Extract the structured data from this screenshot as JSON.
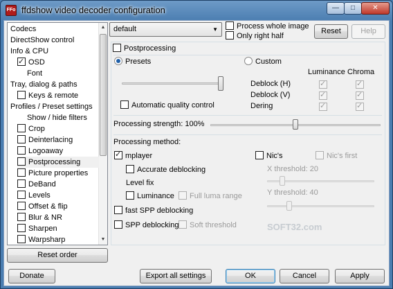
{
  "window": {
    "title": "ffdshow video decoder configuration",
    "icon_text": "FFo",
    "close_glyph": "✕",
    "minimize_glyph": "—",
    "maximize_glyph": "□"
  },
  "tree": {
    "items": [
      {
        "label": "Codecs",
        "indent": 0,
        "checkbox": null
      },
      {
        "label": "DirectShow control",
        "indent": 0,
        "checkbox": null
      },
      {
        "label": "Info & CPU",
        "indent": 0,
        "checkbox": null
      },
      {
        "label": "OSD",
        "indent": 1,
        "checkbox": true
      },
      {
        "label": "Font",
        "indent": 2,
        "checkbox": null
      },
      {
        "label": "Tray, dialog & paths",
        "indent": 0,
        "checkbox": null
      },
      {
        "label": "Keys & remote",
        "indent": 1,
        "checkbox": false
      },
      {
        "label": "Profiles / Preset settings",
        "indent": 0,
        "checkbox": null
      },
      {
        "label": "Show / hide filters",
        "indent": 2,
        "checkbox": null
      },
      {
        "label": "Crop",
        "indent": 1,
        "checkbox": false
      },
      {
        "label": "Deinterlacing",
        "indent": 1,
        "checkbox": false
      },
      {
        "label": "Logoaway",
        "indent": 1,
        "checkbox": false
      },
      {
        "label": "Postprocessing",
        "indent": 1,
        "checkbox": false,
        "selected": true
      },
      {
        "label": "Picture properties",
        "indent": 1,
        "checkbox": false
      },
      {
        "label": "DeBand",
        "indent": 1,
        "checkbox": false
      },
      {
        "label": "Levels",
        "indent": 1,
        "checkbox": false
      },
      {
        "label": "Offset & flip",
        "indent": 1,
        "checkbox": false
      },
      {
        "label": "Blur & NR",
        "indent": 1,
        "checkbox": false
      },
      {
        "label": "Sharpen",
        "indent": 1,
        "checkbox": false
      },
      {
        "label": "Warpsharp",
        "indent": 1,
        "checkbox": false
      }
    ],
    "reset_order_label": "Reset order"
  },
  "preset": {
    "selected": "default",
    "process_whole_image_label": "Process whole image",
    "process_whole_image_checked": false,
    "only_right_half_label": "Only right half",
    "only_right_half_checked": false,
    "reset_label": "Reset",
    "help_label": "Help"
  },
  "postproc": {
    "enable_label": "Postprocessing",
    "enable_checked": false,
    "presets_label": "Presets",
    "presets_selected": true,
    "custom_label": "Custom",
    "custom_selected": false,
    "preset_slider_fraction": 1.0,
    "auto_quality_label": "Automatic quality control",
    "auto_quality_checked": false,
    "col_luminance": "Luminance",
    "col_chroma": "Chroma",
    "rows": [
      {
        "label": "Deblock (H)",
        "luminance": true,
        "chroma": true
      },
      {
        "label": "Deblock (V)",
        "luminance": true,
        "chroma": true
      },
      {
        "label": "Dering",
        "luminance": true,
        "chroma": true
      }
    ],
    "strength_label": "Processing strength: 100%",
    "strength_slider_fraction": 0.5,
    "method_label": "Processing method:",
    "mplayer_label": "mplayer",
    "mplayer_checked": true,
    "accurate_deblock_label": "Accurate deblocking",
    "accurate_deblock_checked": false,
    "level_fix_label": "Level fix",
    "luminance_label": "Luminance",
    "luminance_checked": false,
    "full_luma_label": "Full luma range",
    "full_luma_checked": false,
    "nics_label": "Nic's",
    "nics_checked": false,
    "nics_first_label": "Nic's first",
    "nics_first_checked": false,
    "x_threshold_label": "X threshold: 20",
    "x_threshold_fraction": 0.12,
    "y_threshold_label": "Y threshold: 40",
    "y_threshold_fraction": 0.19,
    "fast_spp_label": "fast SPP deblocking",
    "fast_spp_checked": false,
    "spp_label": "SPP deblocking",
    "spp_checked": false,
    "soft_threshold_label": "Soft threshold",
    "soft_threshold_checked": false
  },
  "watermark": "SOFT32.com",
  "footer": {
    "donate_label": "Donate",
    "export_label": "Export all settings",
    "ok_label": "OK",
    "cancel_label": "Cancel",
    "apply_label": "Apply"
  }
}
